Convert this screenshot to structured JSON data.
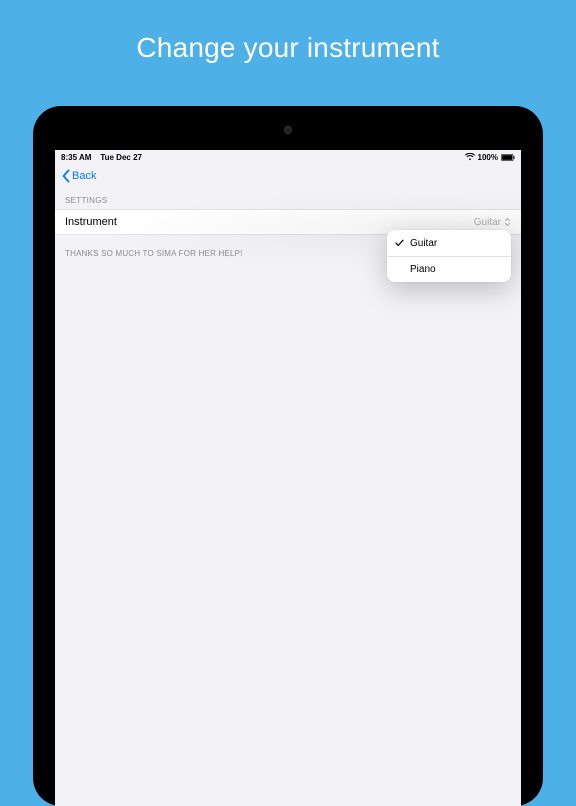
{
  "promo": {
    "title": "Change your instrument"
  },
  "statusBar": {
    "time": "8:35 AM",
    "date": "Tue Dec 27",
    "battery": "100%"
  },
  "nav": {
    "back": "Back"
  },
  "settings": {
    "header": "SETTINGS",
    "row": {
      "label": "Instrument",
      "value": "Guitar"
    },
    "footer": "THANKS SO MUCH TO SIMA FOR HER HELP!"
  },
  "popover": {
    "items": [
      {
        "label": "Guitar",
        "selected": true
      },
      {
        "label": "Piano",
        "selected": false
      }
    ]
  }
}
